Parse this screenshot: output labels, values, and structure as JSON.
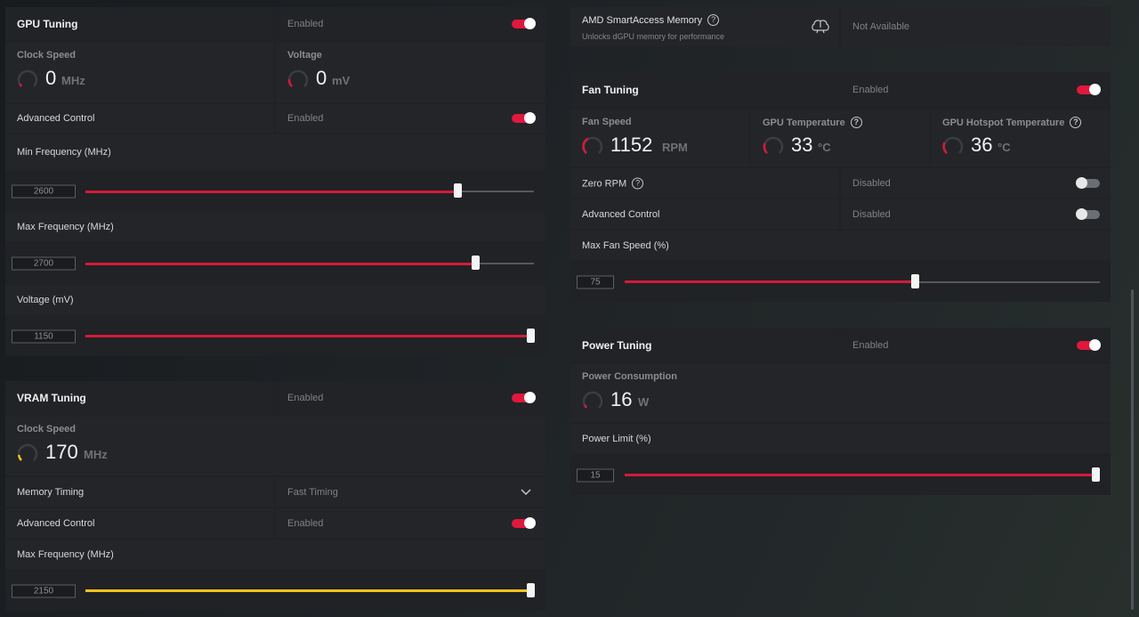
{
  "gpu_tuning": {
    "title": "GPU Tuning",
    "state": "Enabled",
    "clock_speed": {
      "label": "Clock Speed",
      "value": "0",
      "unit": "MHz"
    },
    "voltage": {
      "label": "Voltage",
      "value": "0",
      "unit": "mV"
    },
    "advanced_control": {
      "label": "Advanced Control",
      "state": "Enabled"
    },
    "min_frequency": {
      "label": "Min Frequency (MHz)",
      "value": "2600",
      "fraction": 0.83
    },
    "max_frequency": {
      "label": "Max Frequency (MHz)",
      "value": "2700",
      "fraction": 0.87
    },
    "voltage_slider": {
      "label": "Voltage (mV)",
      "value": "1150",
      "fraction": 1.0
    }
  },
  "vram_tuning": {
    "title": "VRAM Tuning",
    "state": "Enabled",
    "clock_speed": {
      "label": "Clock Speed",
      "value": "170",
      "unit": "MHz"
    },
    "memory_timing": {
      "label": "Memory Timing",
      "value": "Fast Timing"
    },
    "advanced_control": {
      "label": "Advanced Control",
      "state": "Enabled"
    },
    "max_frequency": {
      "label": "Max Frequency (MHz)",
      "value": "2150",
      "fraction": 1.0
    }
  },
  "smart_access": {
    "title": "AMD SmartAccess Memory",
    "subtitle": "Unlocks dGPU memory for performance",
    "state": "Not Available"
  },
  "fan_tuning": {
    "title": "Fan Tuning",
    "state": "Enabled",
    "fan_speed": {
      "label": "Fan Speed",
      "value": "1152",
      "unit": "RPM"
    },
    "gpu_temperature": {
      "label": "GPU Temperature",
      "value": "33",
      "unit": "°C"
    },
    "hotspot_temperature": {
      "label": "GPU Hotspot Temperature",
      "value": "36",
      "unit": "°C"
    },
    "zero_rpm": {
      "label": "Zero RPM",
      "state": "Disabled"
    },
    "advanced_control": {
      "label": "Advanced Control",
      "state": "Disabled"
    },
    "max_fan_speed": {
      "label": "Max Fan Speed (%)",
      "value": "75",
      "fraction": 0.61
    }
  },
  "power_tuning": {
    "title": "Power Tuning",
    "state": "Enabled",
    "power_consumption": {
      "label": "Power Consumption",
      "value": "16",
      "unit": "W"
    },
    "power_limit": {
      "label": "Power Limit (%)",
      "value": "15",
      "fraction": 1.0
    }
  },
  "colors": {
    "accent": "#e0183d",
    "vram_accent": "#f3c21a"
  }
}
